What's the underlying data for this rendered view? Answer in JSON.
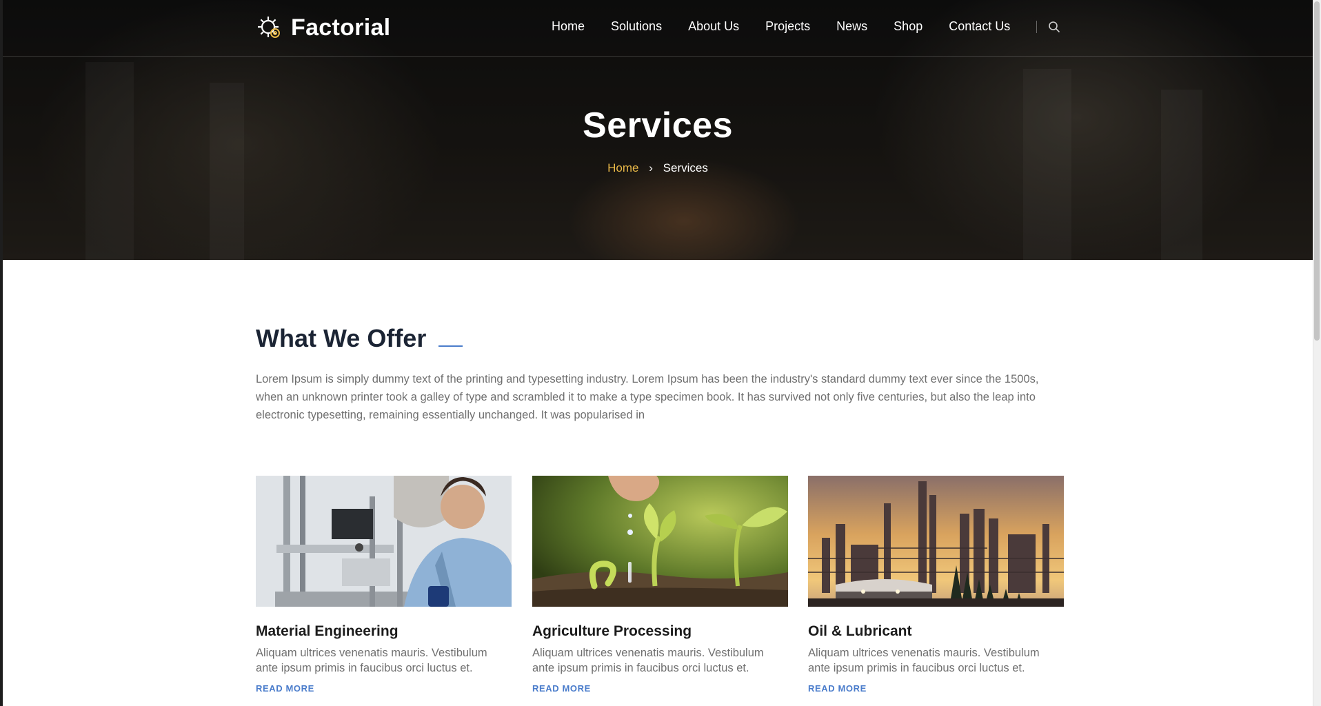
{
  "brand": {
    "name": "Factorial",
    "logo_icon": "gear-icon"
  },
  "nav": {
    "items": [
      {
        "label": "Home"
      },
      {
        "label": "Solutions"
      },
      {
        "label": "About Us"
      },
      {
        "label": "Projects"
      },
      {
        "label": "News"
      },
      {
        "label": "Shop"
      },
      {
        "label": "Contact Us"
      }
    ],
    "search_icon": "search-icon"
  },
  "hero": {
    "title": "Services",
    "breadcrumb": {
      "home": "Home",
      "separator": "›",
      "current": "Services"
    }
  },
  "offer": {
    "title": "What We Offer",
    "intro": "Lorem Ipsum is simply dummy text of the printing and typesetting industry. Lorem Ipsum has been the industry's standard dummy text ever since the 1500s, when an unknown printer took a galley of type and scrambled it to make a type specimen book. It has survived not only five centuries, but also the leap into electronic typesetting, remaining essentially unchanged. It was popularised in"
  },
  "services": [
    {
      "title": "Material Engineering",
      "text": "Aliquam ultrices venenatis mauris. Vestibulum ante ipsum primis in faucibus orci luctus et.",
      "link": "READ MORE"
    },
    {
      "title": "Agriculture Processing",
      "text": "Aliquam ultrices venenatis mauris. Vestibulum ante ipsum primis in faucibus orci luctus et.",
      "link": "READ MORE"
    },
    {
      "title": "Oil & Lubricant",
      "text": "Aliquam ultrices venenatis mauris. Vestibulum ante ipsum primis in faucibus orci luctus et.",
      "link": "READ MORE"
    }
  ],
  "colors": {
    "accent_gold": "#e9b948",
    "accent_blue": "#4a7ccb",
    "heading": "#1b2434",
    "body_text": "#6f6f6f"
  }
}
